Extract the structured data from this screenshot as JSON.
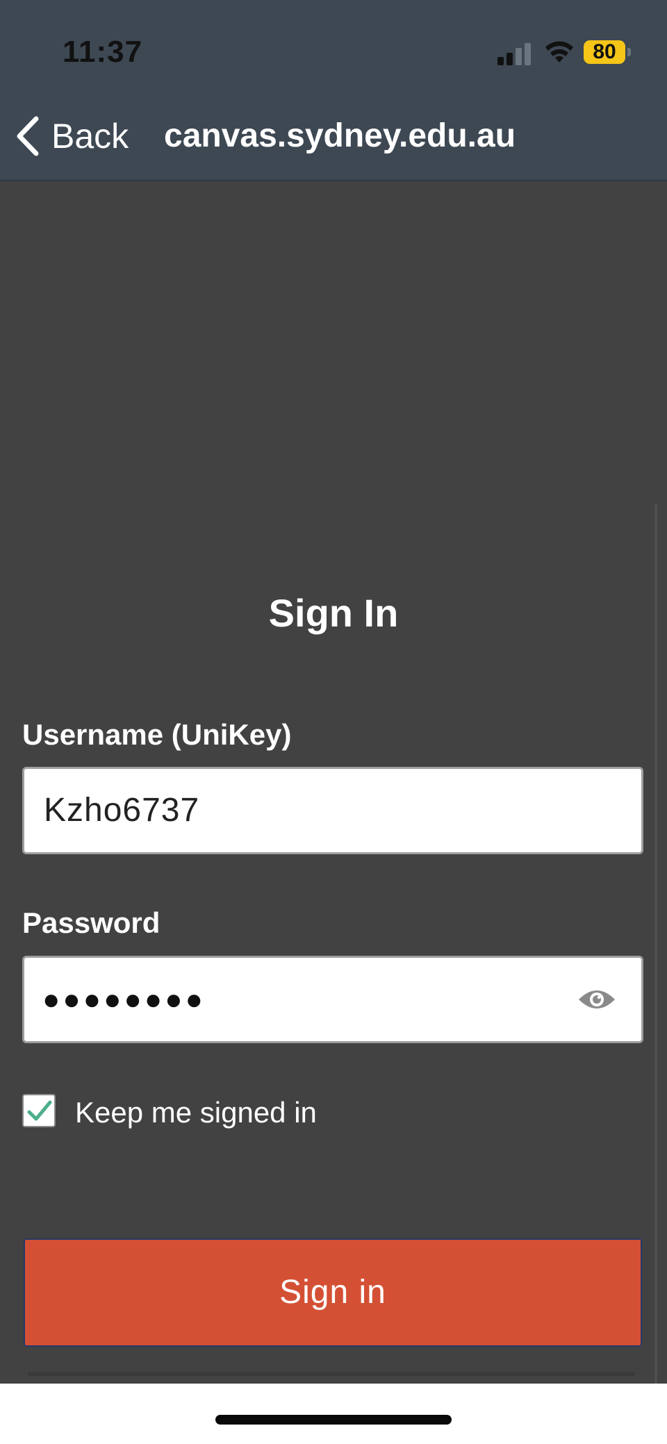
{
  "status_bar": {
    "time": "11:37",
    "battery_level": "80",
    "icons": [
      "signal-icon",
      "wifi-icon",
      "battery-icon"
    ]
  },
  "nav": {
    "back_label": "Back",
    "url": "canvas.sydney.edu.au",
    "back_icon": "chevron-left-icon"
  },
  "form": {
    "heading": "Sign In",
    "username_label": "Username (UniKey)",
    "username_value": "Kzho6737",
    "password_label": "Password",
    "password_mask": "●●●●●●●●",
    "show_password_icon": "eye-icon",
    "keep_signed_in_label": "Keep me signed in",
    "keep_signed_in_checked": true,
    "submit_label": "Sign in"
  },
  "colors": {
    "header_bg": "#3d4853",
    "page_bg": "#424242",
    "primary_button": "#d45034",
    "battery": "#f5c518",
    "checkmark": "#4caf8a"
  }
}
